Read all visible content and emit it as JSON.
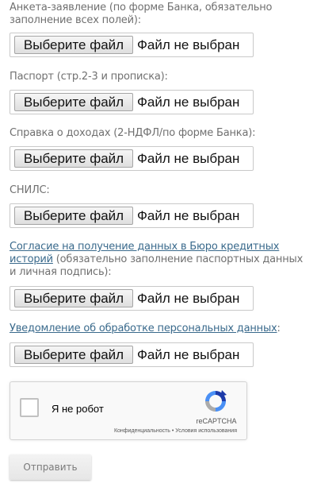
{
  "fields": [
    {
      "label": "Анкета-заявление (по форме Банка, обязательно заполнение всех полей):"
    },
    {
      "label": "Паспорт (стр.2-3 и прописка):"
    },
    {
      "label": "Справка о доходах (2-НДФЛ/по форме Банка):"
    },
    {
      "label": "СНИЛС:"
    },
    {
      "label_link": "Согласие на получение данных в Бюро кредитных историй",
      "label_rest": " (обязательно заполнение паспортных данных и личная подпись):"
    },
    {
      "label_link": "Уведомление об обработке персональных данных",
      "label_rest": ":"
    }
  ],
  "file_input": {
    "button_label": "Выберите файл",
    "status": "Файл не выбран"
  },
  "captcha": {
    "checkbox_label": "Я не робот",
    "brand": "reCAPTCHA",
    "links": "Конфиденциальность • Условия использования"
  },
  "submit_label": "Отправить",
  "colors": {
    "link": "#3a6a8c",
    "label": "#707070"
  }
}
